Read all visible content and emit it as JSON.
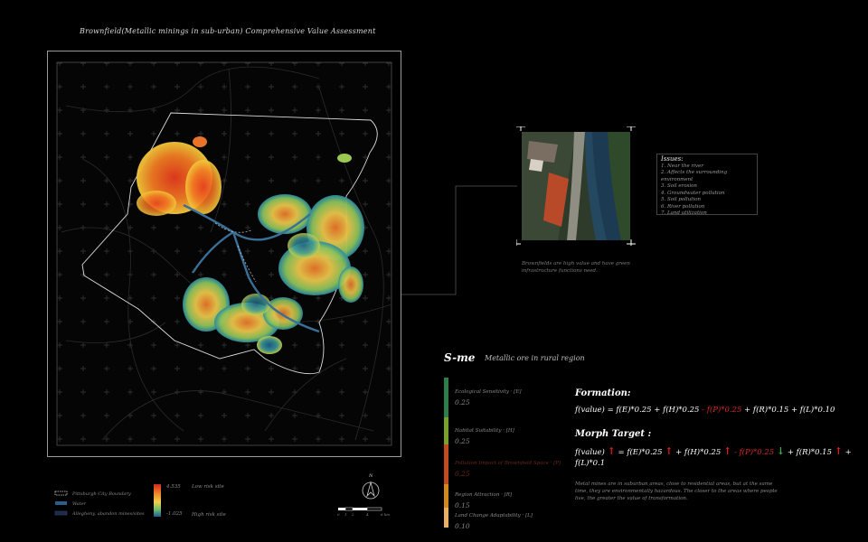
{
  "title": "Brownfield(Metallic minings in sub-urban) Comprehensive Value Assessment",
  "photo_caption": "Brownfields are high value and have green infrastructure functions need.",
  "issues": {
    "title": "Issues:",
    "items": [
      "1. Near the river",
      "2. Affects the surrounding environment",
      "3. Soil erosion",
      "4. Groundwater pollution",
      "5. Soil pollution",
      "6. River pollution",
      "7. Land utilization"
    ]
  },
  "sme": {
    "title": "S-me",
    "subtitle": "Metallic ore in rural region"
  },
  "factors": [
    {
      "label": "Ecological Sensitivity · [E]",
      "weight": "0.25",
      "color": "#2e7d4a"
    },
    {
      "label": "Habitat Suitability · [H]",
      "weight": "0.25",
      "color": "#7aa02a"
    },
    {
      "label": "Pollution Impact of Brownfield Space · [P]",
      "weight": "0.25",
      "color": "#c24a20"
    },
    {
      "label": "Region Attraction · [R]",
      "weight": "0.15",
      "color": "#d38a1a"
    },
    {
      "label": "Land Change Adaptability · [L]",
      "weight": "0.10",
      "color": "#e8b060"
    }
  ],
  "formation": {
    "heading": "Formation:",
    "part1": "f(value) = f(E)*0.25 + f(H)*0.25 ",
    "part_red": "- f(P)*0.25",
    "part2": " + f(R)*0.15 + f(L)*0.10"
  },
  "morph": {
    "heading": "Morph Target :",
    "a": "f(value) ",
    "b": "= f(E)*0.25 ",
    "c": "+ f(H)*0.25 ",
    "d": "- f(P)*0.25 ",
    "e": "+ f(R)*0.15 ",
    "f": "+ f(L)*0.1",
    "up": "↑",
    "down": "↓"
  },
  "note": "Metal mines are in suburban areas, close to residential areas, but at the same time, they are environmentally hazardous. The closer to the areas where people live, the greater the value of transformation.",
  "legend": {
    "boundary": "Pittsburgh City Boundary",
    "water": "Water",
    "mines": "Allegheny, abandon mines/sites",
    "ramp_high": "4.535",
    "ramp_low": "-1.025",
    "low_risk": "Low risk site",
    "high_risk": "High risk site",
    "north": "N",
    "scale_ticks": [
      "0",
      "1",
      "2",
      "4",
      "6 km"
    ]
  },
  "colors": {
    "background": "#000000",
    "accent_red": "#d62a2a",
    "accent_green": "#38b24a"
  }
}
